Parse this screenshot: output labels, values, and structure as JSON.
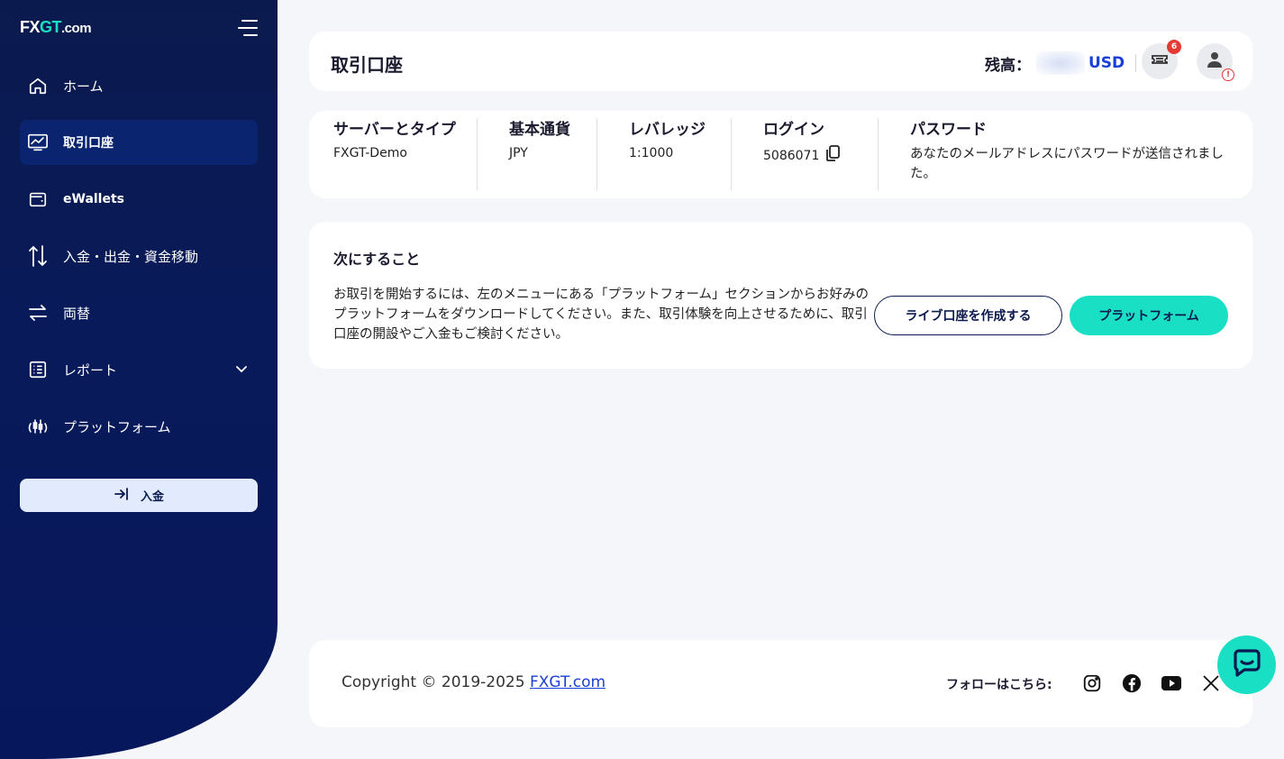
{
  "brand": {
    "logo_fx": "FX",
    "logo_gt": "GT",
    "logo_domain": ".com"
  },
  "sidebar": {
    "items": [
      {
        "label": "ホーム",
        "icon": "home-icon"
      },
      {
        "label": "取引口座",
        "icon": "chart-icon",
        "active": true
      },
      {
        "label": "eWallets",
        "icon": "wallet-icon"
      },
      {
        "label": "入金・出金・資金移動",
        "icon": "transfer-arrows-icon"
      },
      {
        "label": "両替",
        "icon": "exchange-icon"
      },
      {
        "label": "レポート",
        "icon": "report-icon",
        "expandable": true
      },
      {
        "label": "プラットフォーム",
        "icon": "platform-icon"
      }
    ],
    "deposit_label": "入金"
  },
  "header": {
    "title": "取引口座",
    "balance_label": "残高：",
    "currency": "USD",
    "notification_count": "6",
    "warning_mark": "!"
  },
  "account": {
    "server_label": "サーバーとタイプ",
    "server_value": "FXGT-Demo",
    "currency_label": "基本通貨",
    "currency_value": "JPY",
    "leverage_label": "レバレッジ",
    "leverage_value": "1:1000",
    "login_label": "ログイン",
    "login_value": "5086071",
    "password_label": "パスワード",
    "password_value": "あなたのメールアドレスにパスワードが送信されました。"
  },
  "next_steps": {
    "title": "次にすること",
    "text": "お取引を開始するには、左のメニューにある「プラットフォーム」セクションからお好みのプラットフォームをダウンロードしてください。また、取引体験を向上させるために、取引口座の開設やご入金もご検討ください。",
    "live_button": "ライブ口座を作成する",
    "platform_button": "プラットフォーム"
  },
  "footer": {
    "copyright": "Copyright © 2019-2025",
    "link": "FXGT.com",
    "follow": "フォローはこちら:"
  },
  "colors": {
    "sidebar": "#0b1a4e",
    "accent": "#19e0c4",
    "link": "#1a3fd8",
    "badge": "#e53935"
  }
}
